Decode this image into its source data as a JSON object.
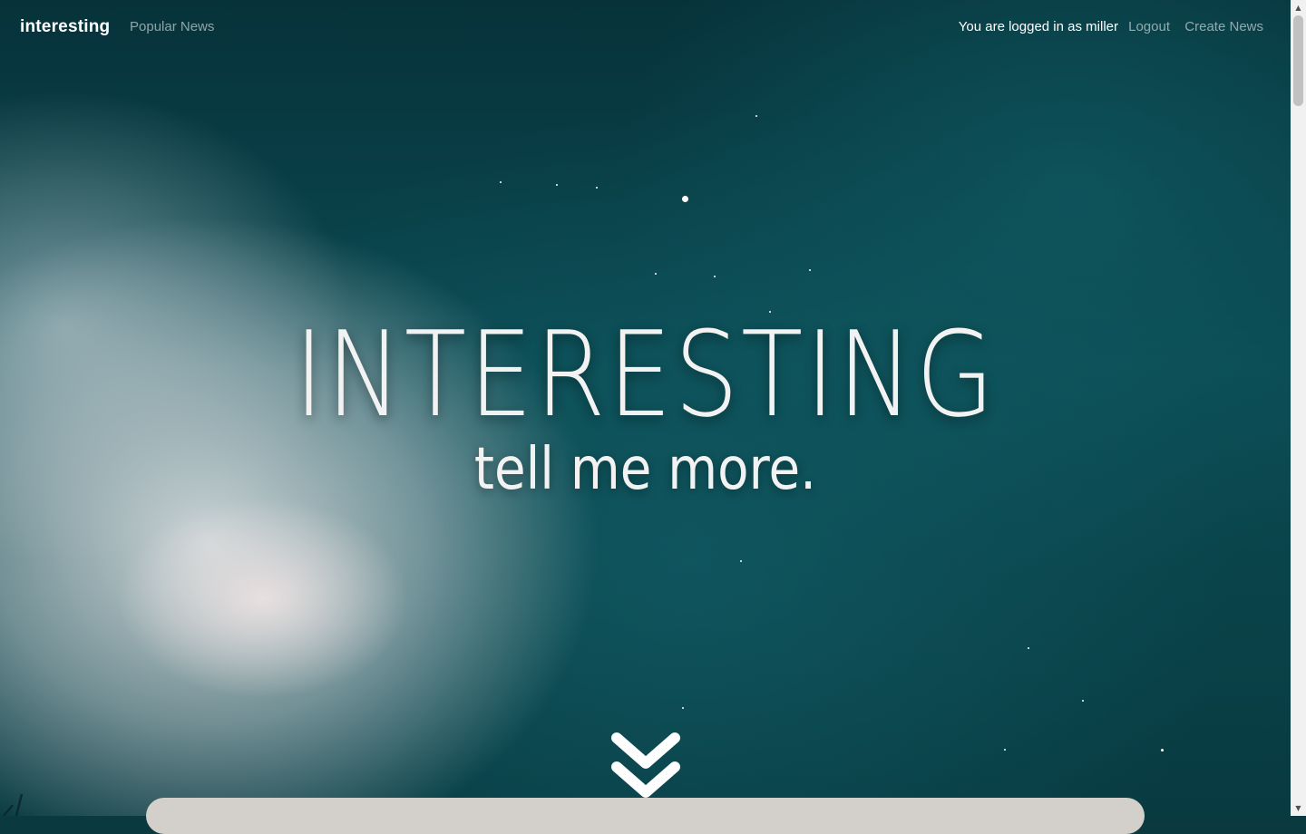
{
  "navbar": {
    "brand": "interesting",
    "popular_news": "Popular News",
    "status": "You are logged in as miller",
    "logout": "Logout",
    "create_news": "Create News"
  },
  "hero": {
    "title": "INTERESTING",
    "subtitle": "tell me more.",
    "scroll_icon": "double-chevron-down-icon"
  },
  "scrollbar": {
    "up_icon": "▲",
    "down_icon": "▼"
  },
  "colors": {
    "text": "#ffffff",
    "muted_link": "rgba(255,255,255,0.55)",
    "card": "#d3d0cc"
  }
}
